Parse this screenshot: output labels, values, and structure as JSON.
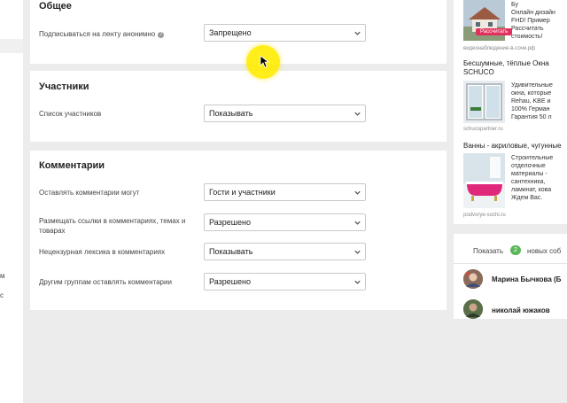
{
  "left_strip": {
    "label_a": "м",
    "label_b": "с"
  },
  "sections": {
    "general": {
      "title": "Общее",
      "rows": [
        {
          "label": "Подписываться на ленту анонимно",
          "value": "Запрещено"
        }
      ]
    },
    "members": {
      "title": "Участники",
      "rows": [
        {
          "label": "Список участников",
          "value": "Показывать"
        }
      ]
    },
    "comments": {
      "title": "Комментарии",
      "rows": [
        {
          "label": "Оставлять комментарии могут",
          "value": "Гости и участники"
        },
        {
          "label": "Размещать ссылки в комментариях, темах и товарах",
          "value": "Разрешено"
        },
        {
          "label": "Нецензурная лексика в комментариях",
          "value": "Показывать"
        },
        {
          "label": "Другим группам оставлять комментарии",
          "value": "Разрешено"
        }
      ]
    }
  },
  "ads": [
    {
      "text_lines": [
        "Бу",
        "Онлайн дизайн",
        "FHD! Пример",
        "Рассчитать",
        "стоимость!"
      ],
      "badge": "Рассчитать",
      "url": "видеонаблюдение-в-сочи.рф"
    },
    {
      "title_lines": [
        "Бесшумные, тёплые Окна",
        "SCHUCO"
      ],
      "text_lines": [
        "Удивительные",
        "окна, которые",
        "Rehau, KBE и",
        "100% Герман",
        "Гарантия 50 л"
      ],
      "url": "schucopartner.ru"
    },
    {
      "title_lines": [
        "Ванны - акриловые, чугунные"
      ],
      "text_lines": [
        "Строительные",
        "отделочные",
        "материалы -",
        "сантехника,",
        "ламинат, кова",
        "Ждем Вас."
      ],
      "url": "podvorye-sochi.ru"
    }
  ],
  "visitors": {
    "show_label": "Показать",
    "new_count": "2",
    "new_label": "новых соб",
    "members": [
      {
        "name": "Марина Бычкова (Б"
      },
      {
        "name": "николай южаков"
      }
    ]
  },
  "colors": {
    "accent_green": "#5bb75b",
    "badge_red": "#e2315d",
    "cursor_yellow": "#ffec00"
  }
}
